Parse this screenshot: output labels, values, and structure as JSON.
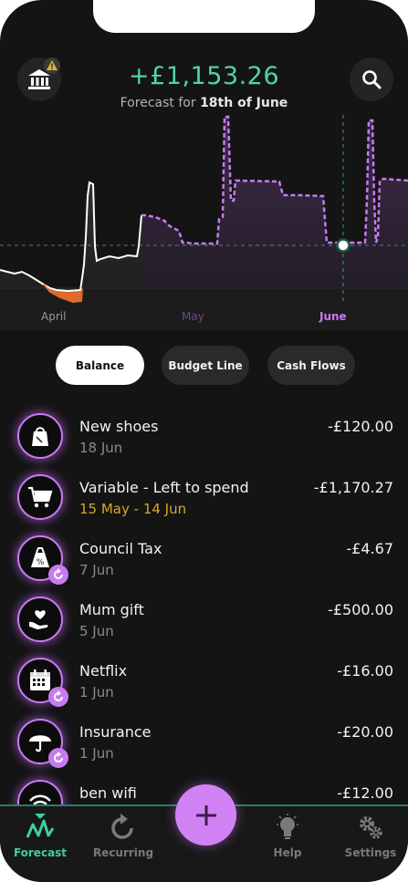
{
  "header": {
    "balance": "+£1,153.26",
    "forecast_prefix": "Forecast for ",
    "forecast_date": "18th of June",
    "bank_icon": "bank-icon",
    "warning_icon": "warning-icon",
    "search_icon": "search-icon"
  },
  "chart": {
    "months": [
      "April",
      "May",
      "June"
    ],
    "month_colors": [
      "#9a9a9a",
      "#6a4a8a",
      "#c77bf0"
    ],
    "colors": {
      "actual": "#ffffff",
      "forecast": "#c77bf0",
      "negative": "#e06a2a",
      "baseline": "#3fbf94"
    }
  },
  "tabs": [
    "Balance",
    "Budget Line",
    "Cash Flows"
  ],
  "transactions": [
    {
      "title": "New shoes",
      "date": "18 Jun",
      "amount": "-£120.00",
      "icon": "shopping-bag-icon",
      "recurring": false,
      "highlight": false
    },
    {
      "title": "Variable - Left to spend",
      "date": "15 May - 14 Jun",
      "amount": "-£1,170.27",
      "icon": "shopping-cart-icon",
      "recurring": false,
      "highlight": true
    },
    {
      "title": "Council Tax",
      "date": "7 Jun",
      "amount": "-£4.67",
      "icon": "tax-bag-icon",
      "recurring": true,
      "highlight": false
    },
    {
      "title": "Mum gift",
      "date": "5 Jun",
      "amount": "-£500.00",
      "icon": "heart-hand-icon",
      "recurring": false,
      "highlight": false
    },
    {
      "title": "Netflix",
      "date": "1 Jun",
      "amount": "-£16.00",
      "icon": "calendar-icon",
      "recurring": true,
      "highlight": false
    },
    {
      "title": "Insurance",
      "date": "1 Jun",
      "amount": "-£20.00",
      "icon": "umbrella-icon",
      "recurring": true,
      "highlight": false
    },
    {
      "title": "ben wifi",
      "date": "",
      "amount": "-£12.00",
      "icon": "wifi-icon",
      "recurring": false,
      "highlight": false
    }
  ],
  "nav": [
    {
      "label": "Forecast",
      "icon": "forecast-icon",
      "active": true
    },
    {
      "label": "Recurring",
      "icon": "recurring-icon",
      "active": false
    },
    {
      "label": "Help",
      "icon": "lightbulb-icon",
      "active": false
    },
    {
      "label": "Settings",
      "icon": "gear-icon",
      "active": false
    }
  ],
  "fab": {
    "icon": "plus-icon"
  }
}
